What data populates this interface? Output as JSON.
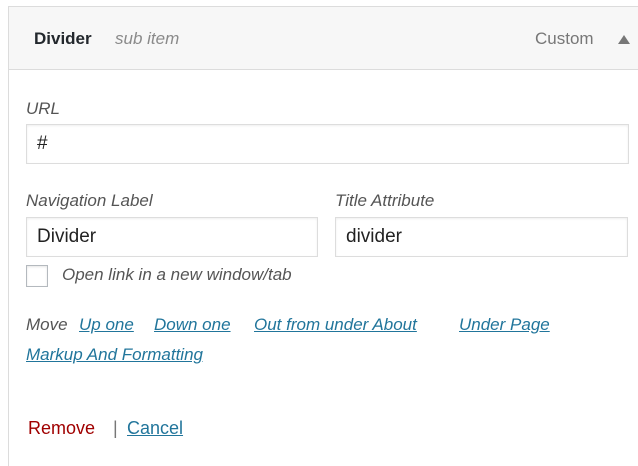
{
  "item": {
    "title": "Divider",
    "subtitle": "sub item",
    "type_label": "Custom",
    "toggle_icon": "triangle-up-icon"
  },
  "fields": {
    "url": {
      "label": "URL",
      "value": "#"
    },
    "nav_label": {
      "label": "Navigation Label",
      "value": "Divider"
    },
    "title_attr": {
      "label": "Title Attribute",
      "value": "divider"
    },
    "new_tab": {
      "label": "Open link in a new window/tab",
      "checked": false
    }
  },
  "move": {
    "label": "Move",
    "links": [
      "Up one",
      "Down one",
      "Out from under About",
      "Under Page",
      "Markup And Formatting"
    ]
  },
  "actions": {
    "remove": "Remove",
    "separator": "|",
    "cancel": "Cancel"
  },
  "colors": {
    "link": "#21759b",
    "remove": "#a00000",
    "header_bg": "#f7f7f7"
  }
}
